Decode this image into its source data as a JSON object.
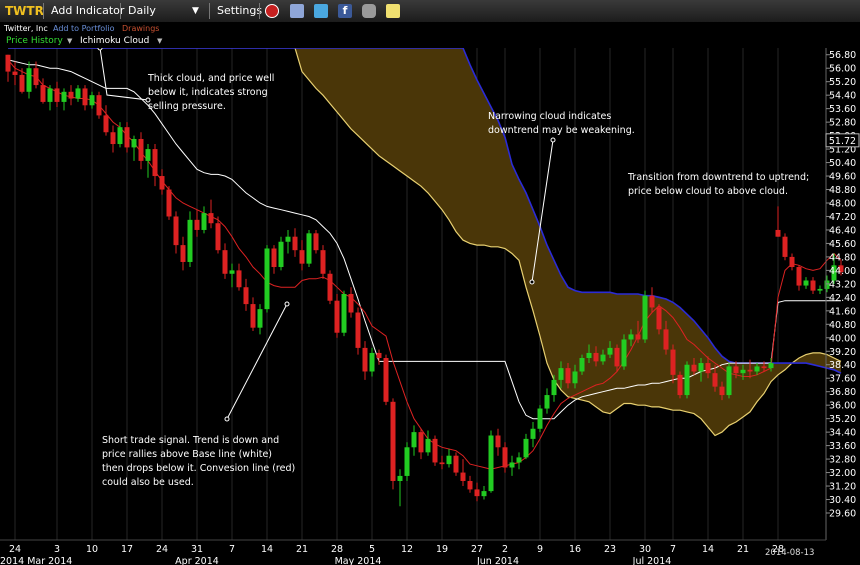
{
  "toolbar": {
    "symbol": "TWTR",
    "add_indicator": "Add Indicator",
    "period": "Daily",
    "settings": "Settings"
  },
  "subbar": {
    "company": "Twitter, Inc",
    "add_portfolio": "Add to Portfolio",
    "drawings": "Drawings"
  },
  "indicator_bar": {
    "price_history": "Price History",
    "ichimoku": "Ichimoku Cloud"
  },
  "colors": {
    "up": "#22cc22",
    "down": "#dd2222",
    "conversion": "#dd2222",
    "base": "#ffffff",
    "cloud_fill": "#4a3608",
    "span_a": "#e8d070",
    "span_b": "#2b2bd6",
    "label_green": "#33dd33"
  },
  "chart_data": {
    "type": "candlestick",
    "title": "",
    "ylim": [
      29.6,
      57.2
    ],
    "y_ticks": [
      "56.80",
      "56.00",
      "55.20",
      "54.40",
      "53.60",
      "52.80",
      "52.00",
      "51.20",
      "50.40",
      "49.60",
      "48.80",
      "48.00",
      "47.20",
      "46.40",
      "45.60",
      "44.80",
      "44.00",
      "43.20",
      "42.40",
      "41.60",
      "40.80",
      "40.00",
      "39.20",
      "38.40",
      "37.60",
      "36.80",
      "36.00",
      "35.20",
      "34.40",
      "33.60",
      "32.80",
      "32.00",
      "31.20",
      "30.40",
      "29.60"
    ],
    "last_price": "51.72",
    "x_day_labels": [
      {
        "i": 1,
        "label": "24"
      },
      {
        "i": 7,
        "label": "3"
      },
      {
        "i": 12,
        "label": "10"
      },
      {
        "i": 17,
        "label": "17"
      },
      {
        "i": 22,
        "label": "24"
      },
      {
        "i": 27,
        "label": "31"
      },
      {
        "i": 32,
        "label": "7"
      },
      {
        "i": 37,
        "label": "14"
      },
      {
        "i": 42,
        "label": "21"
      },
      {
        "i": 47,
        "label": "28"
      },
      {
        "i": 52,
        "label": "5"
      },
      {
        "i": 57,
        "label": "12"
      },
      {
        "i": 62,
        "label": "19"
      },
      {
        "i": 67,
        "label": "27"
      },
      {
        "i": 71,
        "label": "2"
      },
      {
        "i": 76,
        "label": "9"
      },
      {
        "i": 81,
        "label": "16"
      },
      {
        "i": 86,
        "label": "23"
      },
      {
        "i": 91,
        "label": "30"
      },
      {
        "i": 95,
        "label": "7"
      },
      {
        "i": 100,
        "label": "14"
      },
      {
        "i": 105,
        "label": "21"
      },
      {
        "i": 110,
        "label": "28"
      }
    ],
    "x_month_labels": [
      {
        "i": 0,
        "label": "2014 Mar 2014"
      },
      {
        "i": 27,
        "label": "Apr 2014"
      },
      {
        "i": 50,
        "label": "May 2014"
      },
      {
        "i": 70,
        "label": "Jun 2014"
      },
      {
        "i": 92,
        "label": "Jul 2014"
      }
    ],
    "end_date": "2014-08-13",
    "candles": [
      [
        56.8,
        56.8,
        55.2,
        55.8
      ],
      [
        55.8,
        56.4,
        55.0,
        55.6
      ],
      [
        55.6,
        56.0,
        54.5,
        54.6
      ],
      [
        54.6,
        56.4,
        54.2,
        56.0
      ],
      [
        56.0,
        56.4,
        54.8,
        55.0
      ],
      [
        55.0,
        55.4,
        53.9,
        54.0
      ],
      [
        54.0,
        55.0,
        53.5,
        54.8
      ],
      [
        54.8,
        55.2,
        53.7,
        54.0
      ],
      [
        54.0,
        54.8,
        53.5,
        54.6
      ],
      [
        54.6,
        55.0,
        53.8,
        54.2
      ],
      [
        54.2,
        55.0,
        54.0,
        54.8
      ],
      [
        54.8,
        55.0,
        53.5,
        53.8
      ],
      [
        53.8,
        54.6,
        53.6,
        54.4
      ],
      [
        54.4,
        54.6,
        53.0,
        53.2
      ],
      [
        53.2,
        53.8,
        52.0,
        52.2
      ],
      [
        52.2,
        52.6,
        51.0,
        51.5
      ],
      [
        51.5,
        52.8,
        51.3,
        52.5
      ],
      [
        52.5,
        52.8,
        51.0,
        51.3
      ],
      [
        51.3,
        52.0,
        50.5,
        51.8
      ],
      [
        51.8,
        52.2,
        50.0,
        50.5
      ],
      [
        50.5,
        51.5,
        49.5,
        51.2
      ],
      [
        51.2,
        51.5,
        49.0,
        49.6
      ],
      [
        49.6,
        50.0,
        48.5,
        48.8
      ],
      [
        48.8,
        49.0,
        47.0,
        47.2
      ],
      [
        47.2,
        47.5,
        45.0,
        45.5
      ],
      [
        45.5,
        46.0,
        44.0,
        44.5
      ],
      [
        44.5,
        47.5,
        44.2,
        47.0
      ],
      [
        47.0,
        47.6,
        46.0,
        46.4
      ],
      [
        46.4,
        47.8,
        46.2,
        47.4
      ],
      [
        47.4,
        48.2,
        46.5,
        46.8
      ],
      [
        46.8,
        47.2,
        45.0,
        45.2
      ],
      [
        45.2,
        45.6,
        43.5,
        43.8
      ],
      [
        43.8,
        44.4,
        43.0,
        44.0
      ],
      [
        44.0,
        44.4,
        42.8,
        43.0
      ],
      [
        43.0,
        43.5,
        41.6,
        42.0
      ],
      [
        42.0,
        42.4,
        40.4,
        40.6
      ],
      [
        40.6,
        42.0,
        40.2,
        41.7
      ],
      [
        41.7,
        45.5,
        41.5,
        45.3
      ],
      [
        45.3,
        45.5,
        43.8,
        44.2
      ],
      [
        44.2,
        46.0,
        44.0,
        45.7
      ],
      [
        45.7,
        46.4,
        45.0,
        46.0
      ],
      [
        46.0,
        46.5,
        44.8,
        45.2
      ],
      [
        45.2,
        45.8,
        44.0,
        44.4
      ],
      [
        44.4,
        46.4,
        44.2,
        46.2
      ],
      [
        46.2,
        46.4,
        45.0,
        45.2
      ],
      [
        45.2,
        45.5,
        43.5,
        43.8
      ],
      [
        43.8,
        44.0,
        42.0,
        42.2
      ],
      [
        42.2,
        42.6,
        40.0,
        40.3
      ],
      [
        40.3,
        42.8,
        40.1,
        42.6
      ],
      [
        42.6,
        43.0,
        41.2,
        41.5
      ],
      [
        41.5,
        41.8,
        39.0,
        39.4
      ],
      [
        39.4,
        39.8,
        37.5,
        38.0
      ],
      [
        38.0,
        39.4,
        37.7,
        39.1
      ],
      [
        39.1,
        39.3,
        38.4,
        38.8
      ],
      [
        38.8,
        39.0,
        36.0,
        36.2
      ],
      [
        36.2,
        36.4,
        31.0,
        31.5
      ],
      [
        31.5,
        32.2,
        30.0,
        31.8
      ],
      [
        31.8,
        33.8,
        31.5,
        33.5
      ],
      [
        33.5,
        34.8,
        33.0,
        34.4
      ],
      [
        34.4,
        34.6,
        32.8,
        33.2
      ],
      [
        33.2,
        34.5,
        33.0,
        34.0
      ],
      [
        34.0,
        34.2,
        32.4,
        32.6
      ],
      [
        32.6,
        33.0,
        32.2,
        32.5
      ],
      [
        32.5,
        33.4,
        32.3,
        33.0
      ],
      [
        33.0,
        33.2,
        31.8,
        32.0
      ],
      [
        32.0,
        32.8,
        31.2,
        31.5
      ],
      [
        31.5,
        31.8,
        30.8,
        31.0
      ],
      [
        31.0,
        31.4,
        30.3,
        30.6
      ],
      [
        30.6,
        31.2,
        30.4,
        30.9
      ],
      [
        30.9,
        34.5,
        30.8,
        34.2
      ],
      [
        34.2,
        34.6,
        33.0,
        33.5
      ],
      [
        33.5,
        33.8,
        32.0,
        32.3
      ],
      [
        32.3,
        33.0,
        31.8,
        32.6
      ],
      [
        32.6,
        33.2,
        32.2,
        32.9
      ],
      [
        32.9,
        34.3,
        32.8,
        34.0
      ],
      [
        34.0,
        35.0,
        33.5,
        34.6
      ],
      [
        34.6,
        36.0,
        34.4,
        35.8
      ],
      [
        35.8,
        37.0,
        35.5,
        36.6
      ],
      [
        36.6,
        37.8,
        36.2,
        37.5
      ],
      [
        37.5,
        38.6,
        37.0,
        38.2
      ],
      [
        38.2,
        38.5,
        37.0,
        37.3
      ],
      [
        37.3,
        38.4,
        37.0,
        38.0
      ],
      [
        38.0,
        39.0,
        37.8,
        38.8
      ],
      [
        38.8,
        39.6,
        38.5,
        39.1
      ],
      [
        39.1,
        39.5,
        38.3,
        38.6
      ],
      [
        38.6,
        39.3,
        38.4,
        39.0
      ],
      [
        39.0,
        39.8,
        38.8,
        39.4
      ],
      [
        39.4,
        39.6,
        38.0,
        38.3
      ],
      [
        38.3,
        40.2,
        38.1,
        39.9
      ],
      [
        39.9,
        40.5,
        39.5,
        40.2
      ],
      [
        40.2,
        41.0,
        39.7,
        39.9
      ],
      [
        39.9,
        42.8,
        39.7,
        42.5
      ],
      [
        42.5,
        43.0,
        41.5,
        41.8
      ],
      [
        41.8,
        42.0,
        40.2,
        40.5
      ],
      [
        40.5,
        41.0,
        39.0,
        39.3
      ],
      [
        39.3,
        39.6,
        37.3,
        37.8
      ],
      [
        37.8,
        38.0,
        36.4,
        36.6
      ],
      [
        36.6,
        38.6,
        36.4,
        38.4
      ],
      [
        38.4,
        38.8,
        37.8,
        38.0
      ],
      [
        38.0,
        38.8,
        37.4,
        38.5
      ],
      [
        38.5,
        38.9,
        37.6,
        37.9
      ],
      [
        37.9,
        38.4,
        36.8,
        37.1
      ],
      [
        37.1,
        37.4,
        36.3,
        36.6
      ],
      [
        36.6,
        38.5,
        36.4,
        38.3
      ],
      [
        38.3,
        38.6,
        37.6,
        37.9
      ],
      [
        37.9,
        38.4,
        37.5,
        38.1
      ],
      [
        38.1,
        38.7,
        37.6,
        38.0
      ],
      [
        38.0,
        38.5,
        37.8,
        38.3
      ],
      [
        38.3,
        38.6,
        38.0,
        38.2
      ],
      [
        38.2,
        38.8,
        38.0,
        38.5
      ],
      [
        46.4,
        47.8,
        46.0,
        46.0
      ],
      [
        46.0,
        46.2,
        44.6,
        44.8
      ],
      [
        44.8,
        45.0,
        44.0,
        44.2
      ],
      [
        44.2,
        44.3,
        42.8,
        43.1
      ],
      [
        43.1,
        43.6,
        42.9,
        43.4
      ],
      [
        43.4,
        43.6,
        42.6,
        42.8
      ],
      [
        42.8,
        43.1,
        42.6,
        42.9
      ],
      [
        42.9,
        43.7,
        42.7,
        43.4
      ],
      [
        43.4,
        45.0,
        43.2,
        44.3
      ],
      [
        44.3,
        44.6,
        43.7,
        43.9
      ]
    ],
    "conversion_line": [
      56.5,
      56.0,
      55.8,
      55.6,
      55.5,
      55.0,
      54.8,
      54.6,
      54.4,
      54.3,
      54.2,
      54.2,
      54.1,
      53.8,
      53.3,
      52.8,
      52.5,
      52.0,
      51.6,
      51.0,
      50.5,
      49.9,
      49.3,
      48.8,
      48.3,
      48.0,
      47.8,
      47.6,
      47.4,
      47.2,
      47.0,
      46.6,
      46.0,
      45.3,
      44.8,
      44.2,
      43.8,
      43.3,
      43.1,
      43.0,
      43.0,
      43.0,
      43.4,
      43.5,
      43.5,
      43.6,
      43.4,
      43.0,
      42.6,
      42.4,
      42.0,
      41.5,
      40.7,
      40.4,
      40.1,
      38.6,
      37.4,
      36.2,
      35.2,
      34.6,
      34.0,
      33.7,
      33.5,
      33.4,
      33.3,
      33.0,
      32.5,
      32.4,
      32.3,
      32.2,
      32.3,
      32.4,
      32.5,
      32.6,
      32.9,
      33.3,
      34.0,
      34.8,
      35.5,
      36.1,
      36.4,
      36.6,
      36.8,
      37.0,
      37.2,
      37.3,
      37.6,
      38.0,
      38.6,
      39.3,
      40.1,
      41.0,
      41.5,
      41.9,
      41.6,
      41.2,
      40.6,
      39.9,
      39.6,
      39.2,
      38.8,
      38.5,
      38.2,
      37.9,
      37.8,
      37.7,
      37.7,
      37.8,
      38.0,
      38.2,
      42.4,
      44.0,
      44.4,
      44.3,
      44.1,
      44.0,
      44.1,
      44.6,
      45.0,
      44.6
    ],
    "base_line": [
      56.5,
      56.4,
      56.3,
      56.2,
      56.2,
      56.1,
      56.0,
      56.0,
      55.9,
      55.8,
      55.6,
      55.4,
      55.2,
      55.0,
      54.8,
      54.8,
      54.8,
      54.8,
      54.6,
      54.2,
      53.8,
      53.3,
      52.7,
      52.1,
      51.5,
      51.0,
      50.5,
      50.0,
      49.8,
      49.7,
      49.7,
      49.6,
      49.4,
      49.0,
      48.6,
      48.3,
      48.0,
      47.8,
      47.7,
      47.6,
      47.5,
      47.4,
      47.3,
      47.2,
      47.0,
      46.6,
      46.2,
      45.6,
      44.7,
      43.5,
      42.3,
      41.0,
      39.8,
      38.6,
      38.6,
      38.6,
      38.6,
      38.6,
      38.6,
      38.6,
      38.6,
      38.6,
      38.6,
      38.6,
      38.6,
      38.6,
      38.6,
      38.6,
      38.6,
      38.6,
      38.6,
      38.6,
      37.4,
      36.2,
      35.4,
      35.2,
      35.2,
      35.2,
      35.2,
      35.6,
      36.0,
      36.3,
      36.5,
      36.6,
      36.7,
      36.8,
      36.9,
      37.0,
      37.0,
      37.1,
      37.2,
      37.2,
      37.3,
      37.3,
      37.4,
      37.5,
      37.6,
      37.6,
      37.8,
      38.0,
      38.1,
      38.2,
      38.4,
      38.5,
      38.5,
      38.5,
      38.5,
      38.5,
      38.5,
      38.5,
      42.1,
      42.2,
      42.2,
      42.2,
      42.2,
      42.2,
      42.2,
      42.2,
      42.2,
      42.2
    ],
    "senkou_span_a": [
      57.2,
      57.2,
      57.2,
      57.2,
      57.2,
      57.2,
      57.2,
      57.2,
      57.2,
      57.2,
      57.2,
      57.2,
      57.2,
      57.2,
      57.2,
      57.2,
      57.2,
      57.2,
      57.2,
      57.2,
      57.2,
      57.2,
      57.2,
      57.2,
      57.2,
      57.2,
      57.2,
      57.2,
      57.2,
      57.2,
      57.2,
      57.2,
      57.2,
      57.2,
      57.2,
      57.2,
      57.2,
      57.2,
      57.2,
      57.2,
      57.2,
      57.2,
      55.8,
      55.3,
      54.8,
      54.4,
      53.9,
      53.4,
      52.9,
      52.4,
      52.0,
      51.6,
      51.2,
      50.8,
      50.5,
      50.2,
      49.9,
      49.6,
      49.3,
      49.0,
      48.6,
      48.1,
      47.6,
      47.0,
      46.3,
      45.8,
      45.6,
      45.5,
      45.5,
      45.4,
      45.4,
      45.3,
      45.0,
      44.6,
      43.0,
      41.6,
      40.1,
      38.5,
      37.5,
      36.9,
      36.5,
      36.4,
      36.3,
      36.2,
      35.9,
      35.6,
      35.5,
      35.8,
      36.1,
      36.1,
      36.0,
      36.0,
      35.9,
      35.9,
      35.8,
      35.7,
      35.7,
      35.6,
      35.5,
      35.2,
      34.7,
      34.2,
      34.4,
      34.8,
      35.0,
      35.3,
      35.6,
      36.2,
      36.7,
      37.4,
      37.8,
      38.1,
      38.5,
      38.8,
      39.0,
      39.1,
      39.1,
      39.0,
      38.8,
      38.6
    ],
    "senkou_span_b": [
      57.2,
      57.2,
      57.2,
      57.2,
      57.2,
      57.2,
      57.2,
      57.2,
      57.2,
      57.2,
      57.2,
      57.2,
      57.2,
      57.2,
      57.2,
      57.2,
      57.2,
      57.2,
      57.2,
      57.2,
      57.2,
      57.2,
      57.2,
      57.2,
      57.2,
      57.2,
      57.2,
      57.2,
      57.2,
      57.2,
      57.2,
      57.2,
      57.2,
      57.2,
      57.2,
      57.2,
      57.2,
      57.2,
      57.2,
      57.2,
      57.2,
      57.2,
      57.2,
      57.2,
      57.2,
      57.2,
      57.2,
      57.2,
      57.2,
      57.2,
      57.2,
      57.2,
      57.2,
      57.2,
      57.2,
      57.2,
      57.2,
      57.2,
      57.2,
      57.2,
      57.2,
      57.2,
      57.2,
      57.2,
      57.2,
      57.2,
      56.2,
      55.3,
      54.5,
      53.7,
      52.9,
      51.9,
      50.3,
      49.4,
      48.6,
      47.6,
      46.6,
      45.5,
      44.6,
      43.7,
      43.0,
      42.8,
      42.7,
      42.7,
      42.7,
      42.7,
      42.7,
      42.6,
      42.6,
      42.6,
      42.6,
      42.5,
      42.5,
      42.4,
      42.3,
      42.1,
      41.8,
      41.4,
      41.0,
      40.5,
      40.0,
      39.4,
      38.9,
      38.6,
      38.5,
      38.5,
      38.5,
      38.5,
      38.5,
      38.5,
      38.5,
      38.5,
      38.5,
      38.5,
      38.5,
      38.4,
      38.3,
      38.2,
      38.1,
      37.9
    ],
    "annotations": [
      {
        "lines": [
          "Thick cloud, and price well",
          "below it, indicates strong",
          "selling pressure."
        ]
      },
      {
        "lines": [
          "Narrowing cloud indicates",
          "downtrend may be weakening."
        ]
      },
      {
        "lines": [
          "Transition from downtrend to uptrend;",
          "price below cloud to above cloud."
        ]
      },
      {
        "lines": [
          "Short trade signal. Trend is down and",
          "price rallies above Base line (white)",
          "then drops below it. Convesion line (red)",
          "could also be used."
        ]
      }
    ]
  }
}
